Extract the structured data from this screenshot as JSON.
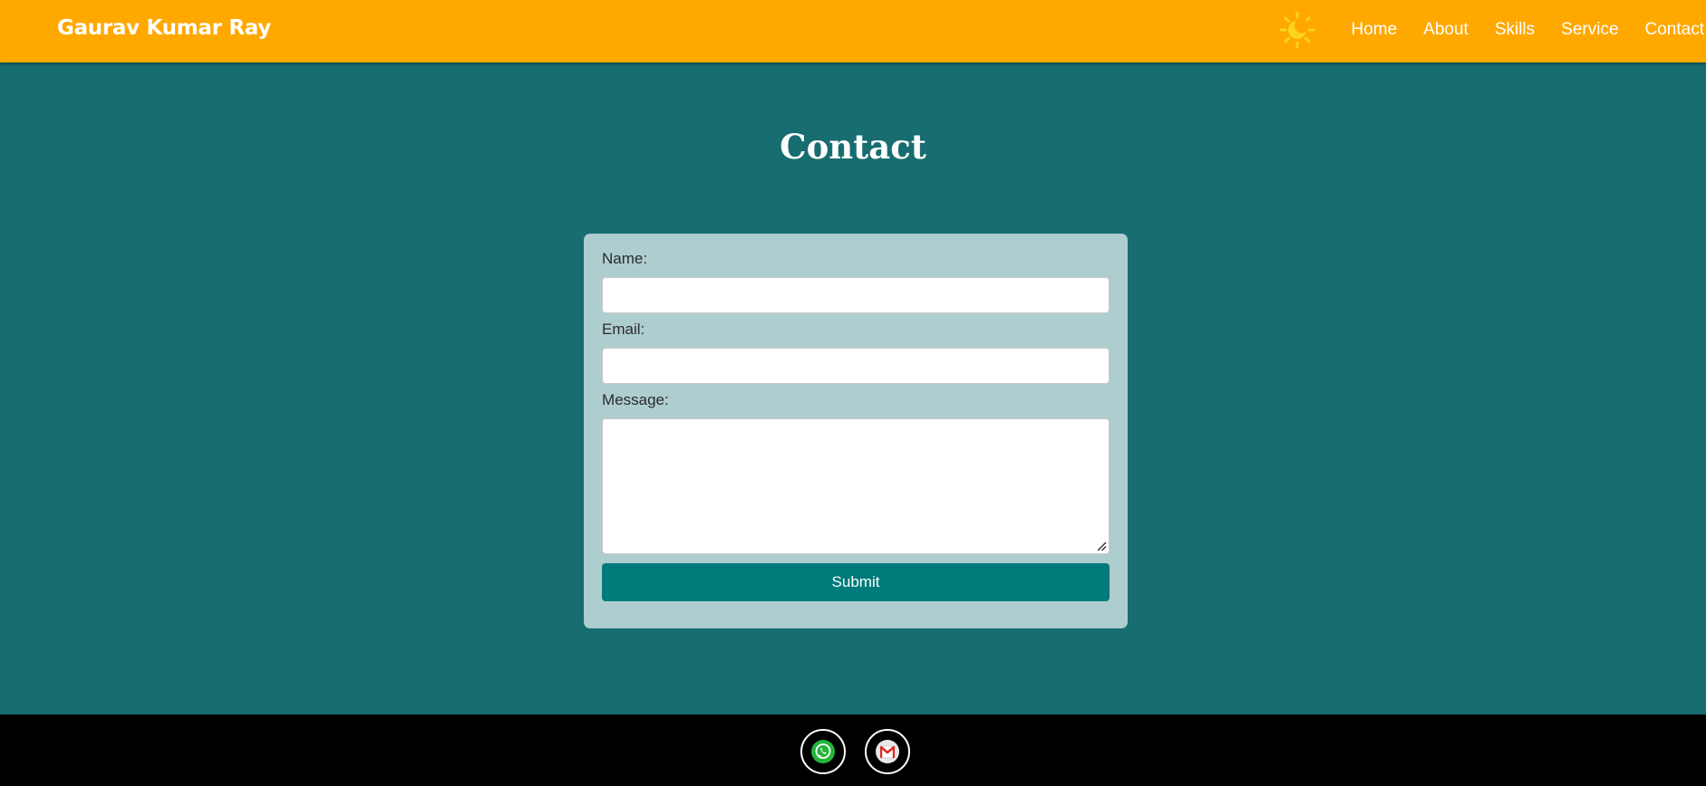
{
  "header": {
    "brand": "Gaurav Kumar Ray",
    "theme_icon": "sun-moon-icon",
    "nav": [
      {
        "label": "Home"
      },
      {
        "label": "About"
      },
      {
        "label": "Skills"
      },
      {
        "label": "Service"
      },
      {
        "label": "Contact"
      }
    ]
  },
  "main": {
    "title": "Contact"
  },
  "form": {
    "name_label": "Name:",
    "name_value": "",
    "email_label": "Email:",
    "email_value": "",
    "message_label": "Message:",
    "message_value": "",
    "submit_label": "Submit"
  },
  "footer": {
    "social": [
      {
        "icon": "whatsapp-icon"
      },
      {
        "icon": "gmail-icon"
      }
    ]
  },
  "colors": {
    "header_bg": "#ffa800",
    "page_bg": "#176d6f",
    "card_bg": "#aecdcf",
    "submit_bg": "#007b7b",
    "footer_bg": "#000000"
  }
}
